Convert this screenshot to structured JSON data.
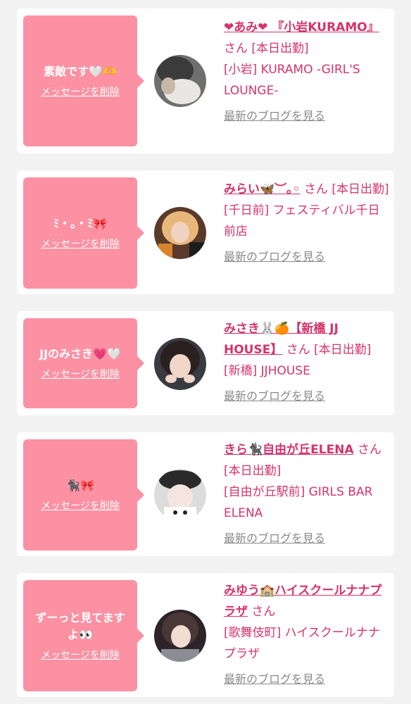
{
  "common": {
    "delete_label": "メッセージを削除",
    "blog_label": "最新のブログを見る",
    "san_label": "さん"
  },
  "cards": [
    {
      "message": "素敵です🤍🫶",
      "name": "❤あみ❤ 『小岩KURAMO』",
      "status": "[本日出勤]",
      "shop": "[小岩] KURAMO -GIRL'S LOUNGE-"
    },
    {
      "message": "ﾐ・｡・ﾐ🎀",
      "name": "みらい🦋︶｡◦",
      "status": "[本日出勤]",
      "shop": "[千日前] フェスティバル千日前店"
    },
    {
      "message": "JJのみさき💗🤍",
      "name": "みさき🐰🍊【新橋 JJ HOUSE】",
      "status": "[本日出勤]",
      "shop": "[新橋] JJHOUSE"
    },
    {
      "message": "🐈‍⬛🎀",
      "name": "きら🐈‍⬛自由が丘ELENA",
      "status": "[本日出勤]",
      "shop": "[自由が丘駅前] GIRLS BAR ELENA"
    },
    {
      "message": "ずーっと見てますよ👀",
      "name": "みゆう🏫ハイスクールナナプラザ",
      "status": "",
      "shop": "[歌舞伎町] ハイスクールナナプラザ"
    }
  ]
}
